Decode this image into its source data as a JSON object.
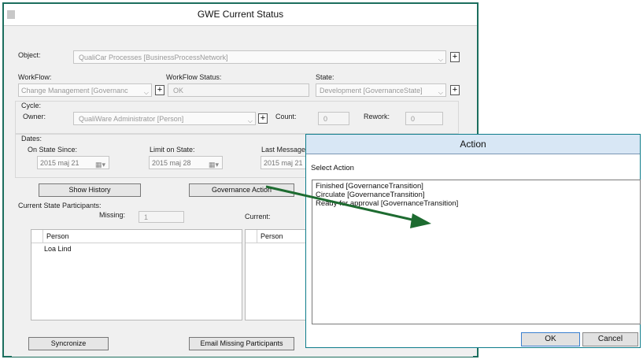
{
  "window": {
    "title": "GWE Current Status",
    "object_label": "Object:",
    "object_value": "QualiCar Processes [BusinessProcessNetwork]",
    "workflow_label": "WorkFlow:",
    "workflow_value": "Change Management [Governanc",
    "workflow_status_label": "WorkFlow Status:",
    "workflow_status_value": "OK",
    "state_label": "State:",
    "state_value": "Development [GovernanceState]",
    "cycle_label": "Cycle:",
    "owner_label": "Owner:",
    "owner_value": "QualiWare Administrator [Person]",
    "count_label": "Count:",
    "count_value": "0",
    "rework_label": "Rework:",
    "rework_value": "0",
    "dates_label": "Dates:",
    "on_state_since_label": "On State Since:",
    "on_state_since_value": "2015 maj 21",
    "limit_on_state_label": "Limit on State:",
    "limit_on_state_value": "2015 maj 28",
    "last_message_label": "Last Message:",
    "last_message_value": "2015 maj 21",
    "show_history_label": "Show History",
    "governance_action_label": "Governance Action",
    "participants_label": "Current State Participants:",
    "missing_label": "Missing:",
    "missing_value": "1",
    "current_label": "Current:",
    "missing_list_header": "Person",
    "missing_list_items": [
      "Loa Lind"
    ],
    "current_list_header": "Person",
    "syncronize_label": "Syncronize",
    "email_missing_label": "Email Missing Participants",
    "plus_symbol": "+"
  },
  "dialog": {
    "title": "Action",
    "prompt": "Select Action",
    "actions": [
      "Finished [GovernanceTransition]",
      "Circulate [GovernanceTransition]",
      "Ready for approval [GovernanceTransition]"
    ],
    "ok_label": "OK",
    "cancel_label": "Cancel"
  },
  "colors": {
    "window_border": "#1c6e5e",
    "dialog_border": "#0d7c8a",
    "dialog_title_bg": "#d8e7f5",
    "arrow": "#1d6b30"
  },
  "icons": {
    "dropdown": "chevron-down-icon",
    "calendar": "calendar-icon",
    "add": "plus-icon"
  }
}
